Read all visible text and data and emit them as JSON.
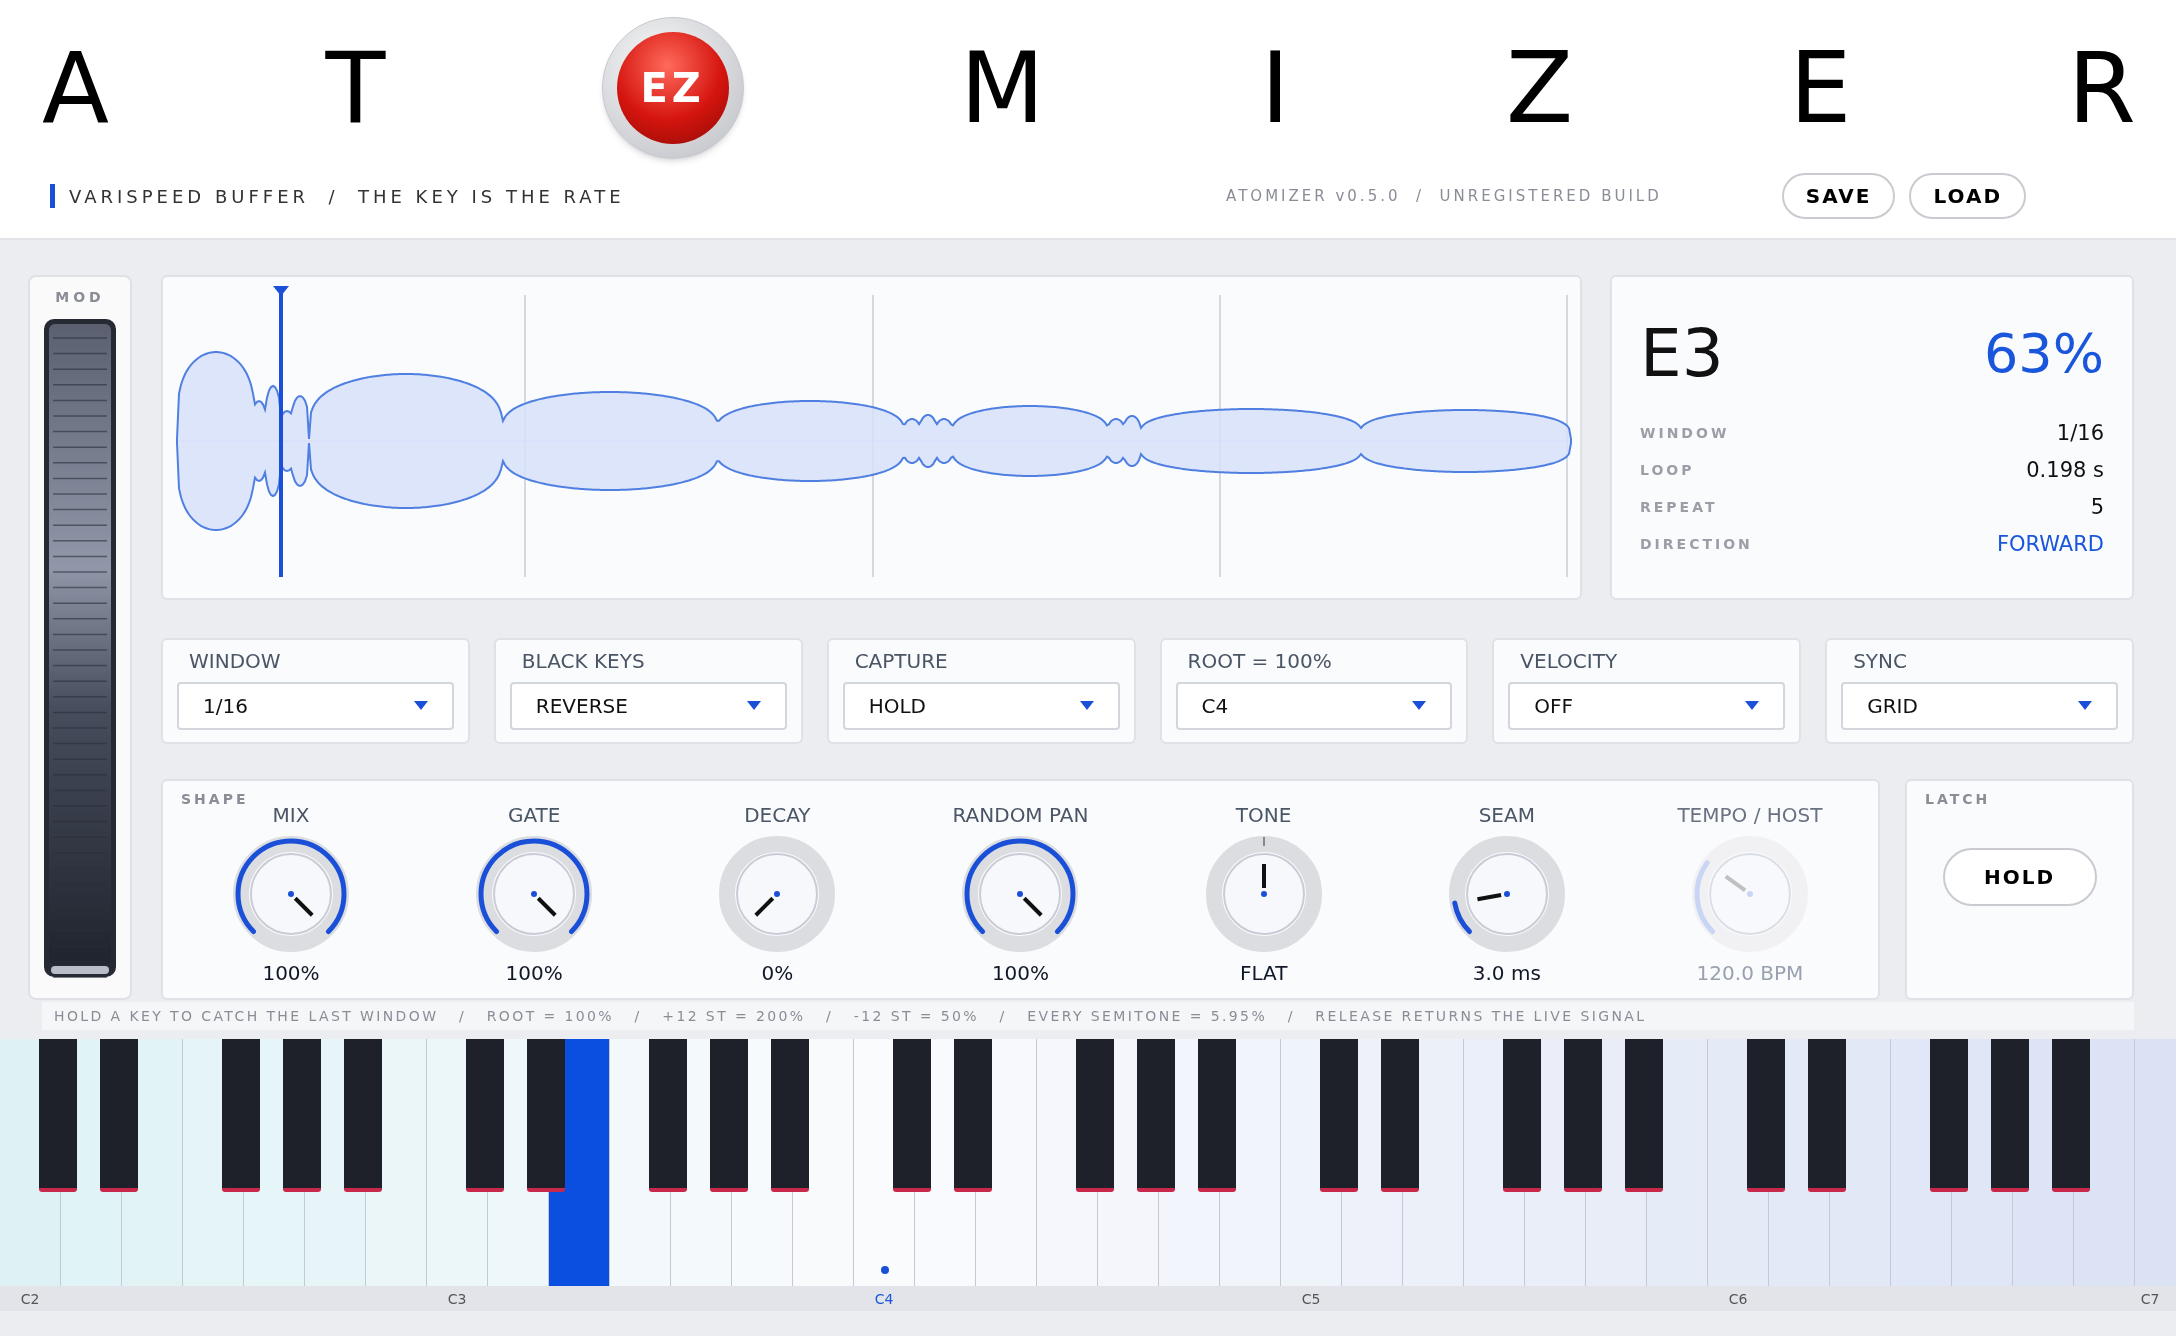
{
  "title": [
    {
      "kind": "letter",
      "text": "A"
    },
    {
      "kind": "letter",
      "text": "T"
    },
    {
      "kind": "logo",
      "text": "EZ"
    },
    {
      "kind": "letter",
      "text": "M"
    },
    {
      "kind": "letter",
      "text": "I"
    },
    {
      "kind": "letter",
      "text": "Z"
    },
    {
      "kind": "letter",
      "text": "E"
    },
    {
      "kind": "letter",
      "text": "R"
    }
  ],
  "subtitle": "VARISPEED BUFFER  /  THE KEY IS THE RATE",
  "version": "ATOMIZER v0.5.0  /  UNREGISTERED BUILD",
  "header_buttons": [
    "SAVE",
    "LOAD"
  ],
  "mod": {
    "label": "MOD"
  },
  "info": {
    "note": "E3",
    "percent": "63%",
    "rows": [
      {
        "label": "WINDOW",
        "value": "1/16",
        "accent": false
      },
      {
        "label": "LOOP",
        "value": "0.198 s",
        "accent": false
      },
      {
        "label": "REPEAT",
        "value": "5",
        "accent": false
      },
      {
        "label": "DIRECTION",
        "value": "FORWARD",
        "accent": true
      }
    ]
  },
  "dropdowns": [
    {
      "label": "WINDOW",
      "value": "1/16"
    },
    {
      "label": "BLACK KEYS",
      "value": "REVERSE"
    },
    {
      "label": "CAPTURE",
      "value": "HOLD"
    },
    {
      "label": "ROOT = 100%",
      "value": "C4"
    },
    {
      "label": "VELOCITY",
      "value": "OFF"
    },
    {
      "label": "SYNC",
      "value": "GRID"
    }
  ],
  "shape": {
    "label": "SHAPE",
    "knobs": [
      {
        "label": "MIX",
        "value": "100%",
        "kind": "unipolar",
        "disabled": false
      },
      {
        "label": "GATE",
        "value": "100%",
        "kind": "unipolar",
        "disabled": false
      },
      {
        "label": "DECAY",
        "value": "0%",
        "kind": "unipolar",
        "disabled": false
      },
      {
        "label": "RANDOM PAN",
        "value": "100%",
        "kind": "unipolar",
        "disabled": false
      },
      {
        "label": "TONE",
        "value": "FLAT",
        "kind": "bipolar",
        "disabled": false
      },
      {
        "label": "SEAM",
        "value": "3.0 ms",
        "kind": "unipolar",
        "disabled": false
      },
      {
        "label": "TEMPO / HOST",
        "value": "120.0 BPM",
        "kind": "unipolar",
        "disabled": true
      }
    ]
  },
  "latch": {
    "label": "LATCH",
    "button": "HOLD"
  },
  "hint": "HOLD A KEY TO CATCH THE LAST WINDOW   /   ROOT = 100%   /   +12 ST = 200%   /   -12 ST = 50%   /   EVERY SEMITONE = 5.95%   /   RELEASE RETURNS THE LIVE SIGNAL",
  "keyboard": {
    "white_keys": [
      {
        "label": "C2",
        "pressed": false,
        "root": false
      },
      {
        "pressed": false,
        "root": false
      },
      {
        "pressed": false,
        "root": false
      },
      {
        "pressed": false,
        "root": false
      },
      {
        "pressed": false,
        "root": false
      },
      {
        "pressed": false,
        "root": false
      },
      {
        "pressed": false,
        "root": false
      },
      {
        "label": "C3",
        "pressed": false,
        "root": false
      },
      {
        "pressed": false,
        "root": false
      },
      {
        "pressed": true,
        "root": false
      },
      {
        "pressed": false,
        "root": false
      },
      {
        "pressed": false,
        "root": false
      },
      {
        "pressed": false,
        "root": false
      },
      {
        "pressed": false,
        "root": false
      },
      {
        "label": "C4",
        "pressed": false,
        "root": true
      },
      {
        "pressed": false,
        "root": false
      },
      {
        "pressed": false,
        "root": false
      },
      {
        "pressed": false,
        "root": false
      },
      {
        "pressed": false,
        "root": false
      },
      {
        "pressed": false,
        "root": false
      },
      {
        "pressed": false,
        "root": false
      },
      {
        "label": "C5",
        "pressed": false,
        "root": false
      },
      {
        "pressed": false,
        "root": false
      },
      {
        "pressed": false,
        "root": false
      },
      {
        "pressed": false,
        "root": false
      },
      {
        "pressed": false,
        "root": false
      },
      {
        "pressed": false,
        "root": false
      },
      {
        "pressed": false,
        "root": false
      },
      {
        "label": "C6",
        "pressed": false,
        "root": false
      },
      {
        "pressed": false,
        "root": false
      },
      {
        "pressed": false,
        "root": false
      },
      {
        "pressed": false,
        "root": false
      },
      {
        "pressed": false,
        "root": false
      },
      {
        "pressed": false,
        "root": false
      },
      {
        "pressed": false,
        "root": false
      },
      {
        "label": "C7",
        "pressed": false,
        "root": false
      }
    ]
  }
}
